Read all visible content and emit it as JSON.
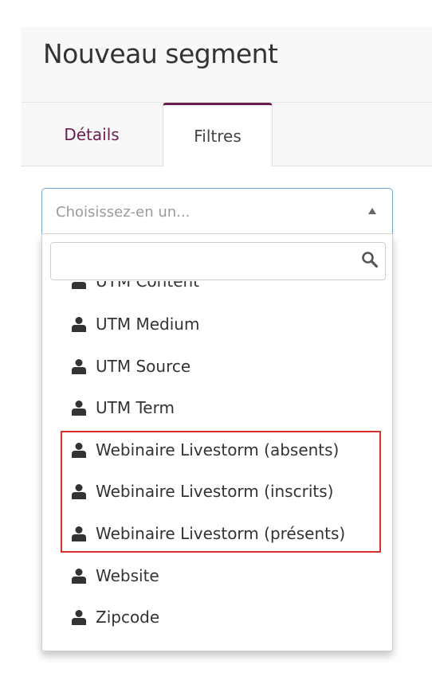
{
  "page": {
    "title": "Nouveau segment"
  },
  "tabs": [
    {
      "label": "Détails",
      "active": false
    },
    {
      "label": "Filtres",
      "active": true
    }
  ],
  "select": {
    "placeholder": "Choisissez-en un...",
    "search_value": ""
  },
  "options": [
    {
      "label": "UTM Content",
      "icon": "user-icon"
    },
    {
      "label": "UTM Medium",
      "icon": "user-icon"
    },
    {
      "label": "UTM Source",
      "icon": "user-icon"
    },
    {
      "label": "UTM Term",
      "icon": "user-icon"
    },
    {
      "label": "Webinaire Livestorm (absents)",
      "icon": "user-icon"
    },
    {
      "label": "Webinaire Livestorm (inscrits)",
      "icon": "user-icon"
    },
    {
      "label": "Webinaire Livestorm (présents)",
      "icon": "user-icon"
    },
    {
      "label": "Website",
      "icon": "user-icon"
    },
    {
      "label": "Zipcode",
      "icon": "user-icon"
    }
  ],
  "colors": {
    "accent": "#6b1c4f",
    "highlight_border": "#d6302a",
    "focus_border": "#6fa8dc"
  }
}
